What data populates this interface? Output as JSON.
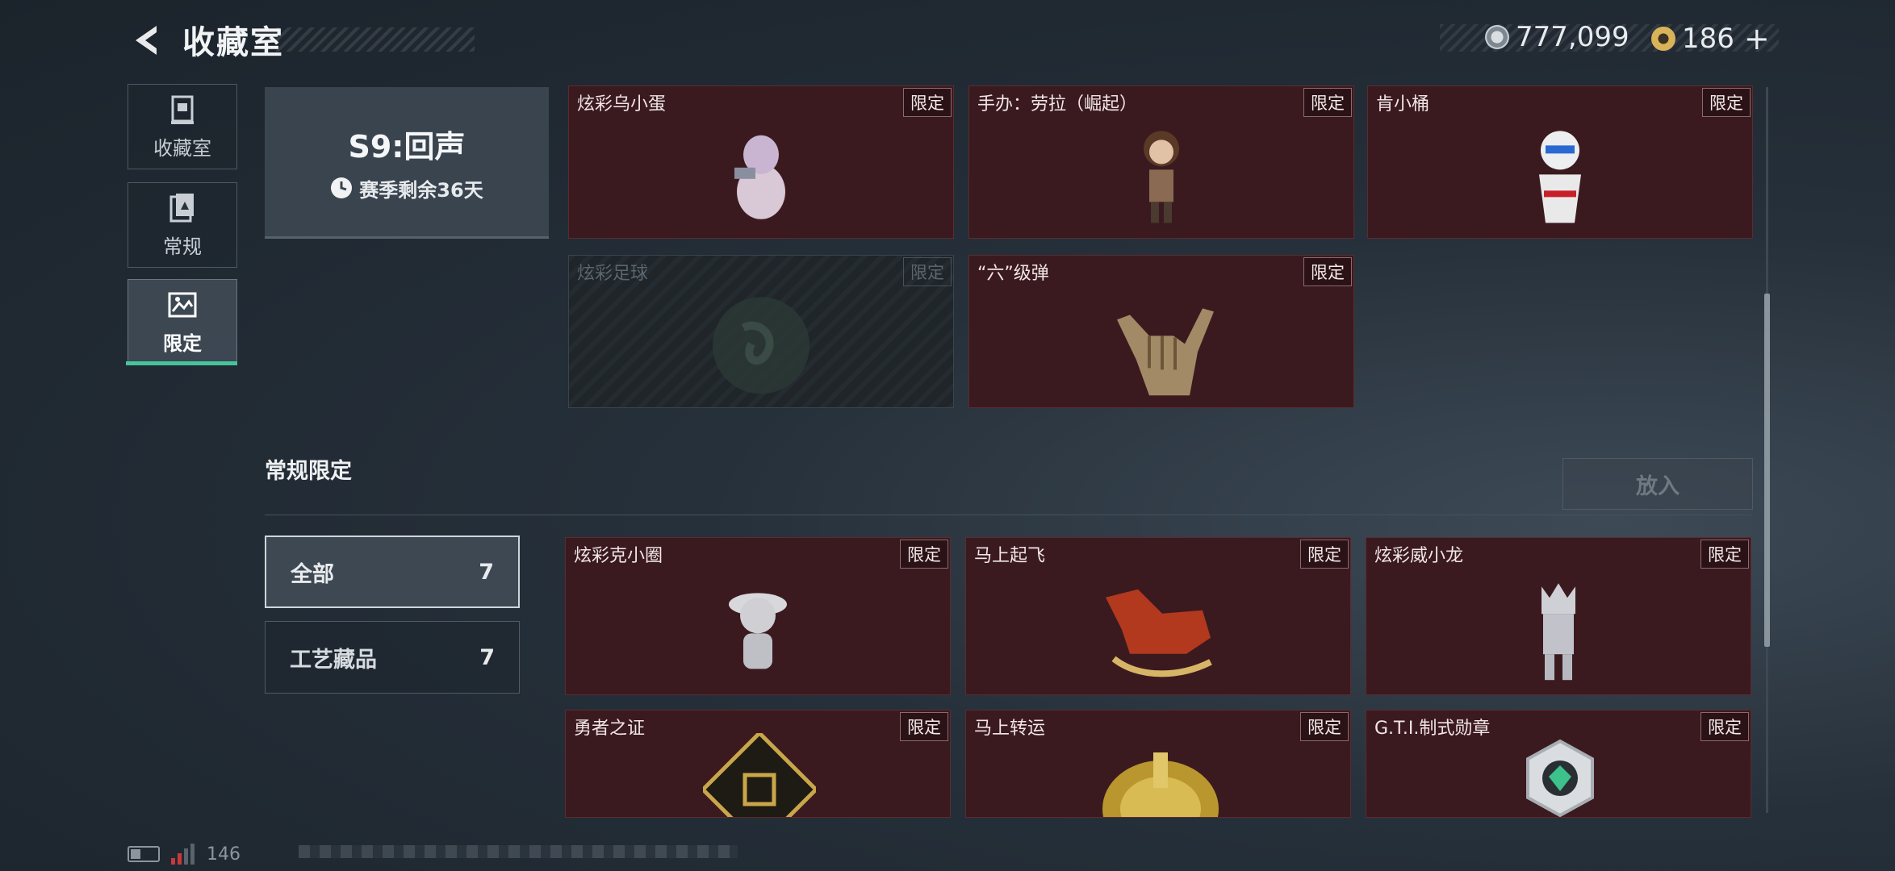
{
  "header": {
    "title": "收藏室",
    "currency_1": "777,099",
    "currency_2": "186",
    "currency_2_add": "+"
  },
  "sidebar": {
    "items": [
      {
        "label": "收藏室",
        "icon": "trophy-icon"
      },
      {
        "label": "常规",
        "icon": "cards-icon"
      },
      {
        "label": "限定",
        "icon": "limited-pic-icon"
      }
    ],
    "active_index": 2
  },
  "season": {
    "name": "S9:回声",
    "remaining": "赛季剩余36天"
  },
  "season_items": [
    {
      "name": "炫彩乌小蛋",
      "badge": "限定",
      "locked": false
    },
    {
      "name": "手办：劳拉（崛起）",
      "badge": "限定",
      "locked": false
    },
    {
      "name": "肯小桶",
      "badge": "限定",
      "locked": false
    },
    {
      "name": "炫彩足球",
      "badge": "限定",
      "locked": true
    },
    {
      "name": "“六”级弹",
      "badge": "限定",
      "locked": false
    }
  ],
  "regular_section": {
    "title": "常规限定",
    "put_button": "放入",
    "filters": [
      {
        "label": "全部",
        "count": "7"
      },
      {
        "label": "工艺藏品",
        "count": "7"
      }
    ],
    "items": [
      {
        "name": "炫彩克小圈",
        "badge": "限定"
      },
      {
        "name": "马上起飞",
        "badge": "限定"
      },
      {
        "name": "炫彩威小龙",
        "badge": "限定"
      },
      {
        "name": "勇者之证",
        "badge": "限定"
      },
      {
        "name": "马上转运",
        "badge": "限定"
      },
      {
        "name": "G.T.I.制式勋章",
        "badge": "限定"
      }
    ]
  },
  "status_bar": {
    "number": "146"
  },
  "colors": {
    "card_bg": "#3b1a1f",
    "accent_green": "#46c49a",
    "background": "#1b232b"
  }
}
